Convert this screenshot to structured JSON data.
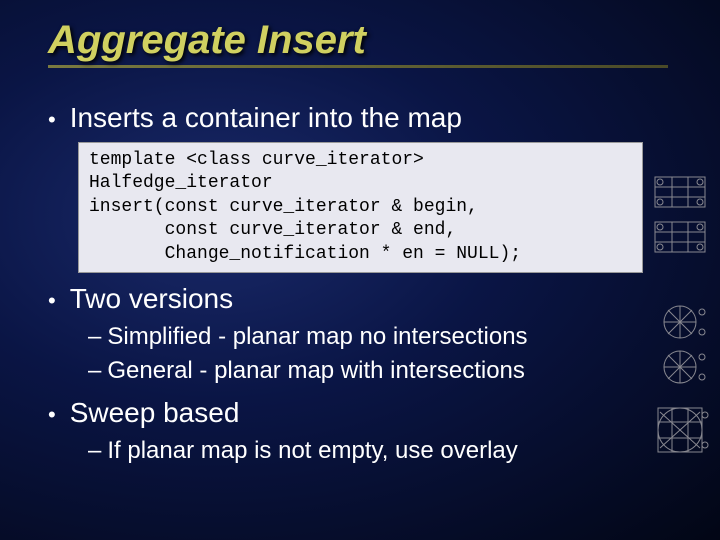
{
  "title": "Aggregate Insert",
  "bullets": {
    "b1": "Inserts a container into the map",
    "b2": "Two versions",
    "b2_sub1": "Simplified - planar map no intersections",
    "b2_sub2": "General - planar map with intersections",
    "b3": "Sweep based",
    "b3_sub1": "If planar map is not empty, use overlay"
  },
  "code": "template <class curve_iterator>\nHalfedge_iterator\ninsert(const curve_iterator & begin,\n       const curve_iterator & end,\n       Change_notification * en = NULL);"
}
